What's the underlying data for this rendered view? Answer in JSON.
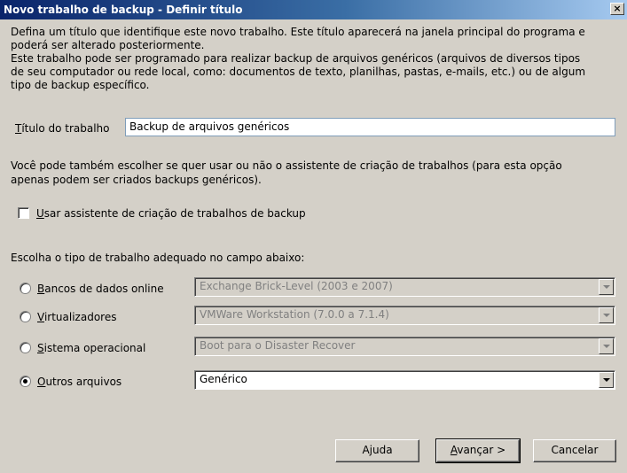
{
  "window": {
    "title": "Novo trabalho de backup - Definir título",
    "close_glyph": "×"
  },
  "intro": {
    "line1": "Defina um título que identifique este novo trabalho. Este título aparecerá na janela principal do programa e",
    "line2": "poderá ser alterado posteriormente.",
    "line3": "Este trabalho pode ser programado para realizar backup de arquivos genéricos (arquivos de diversos tipos",
    "line4": "de seu computador ou rede local, como: documentos de texto, planilhas, pastas, e-mails, etc.) ou de algum",
    "line5": "tipo de backup específico."
  },
  "title_field": {
    "label_mnemonic": "T",
    "label_rest": "ítulo do trabalho",
    "value": "Backup de arquivos genéricos"
  },
  "wizard_text": {
    "line1": "Você pode também escolher se quer usar ou não o assistente de criação de trabalhos (para esta opção",
    "line2": "apenas podem ser criados backups genéricos)."
  },
  "wizard_checkbox": {
    "label_mnemonic": "U",
    "label_rest": "sar assistente de criação de trabalhos de backup",
    "checked": false
  },
  "type_prompt": "Escolha o tipo de trabalho adequado no campo abaixo:",
  "job_types": [
    {
      "mnemonic": "B",
      "rest": "ancos de dados online",
      "combo_value": "Exchange Brick-Level (2003 e 2007)",
      "selected": false
    },
    {
      "mnemonic": "V",
      "rest": "irtualizadores",
      "combo_value": "VMWare Workstation (7.0.0 a 7.1.4)",
      "selected": false
    },
    {
      "mnemonic": "S",
      "rest": "istema operacional",
      "combo_value": "Boot para o Disaster Recover",
      "selected": false
    },
    {
      "mnemonic": "O",
      "rest": "utros arquivos",
      "combo_value": "Genérico",
      "selected": true
    }
  ],
  "buttons": {
    "help": "Ajuda",
    "next_mnemonic": "A",
    "next_rest": "vançar >",
    "cancel": "Cancelar"
  }
}
